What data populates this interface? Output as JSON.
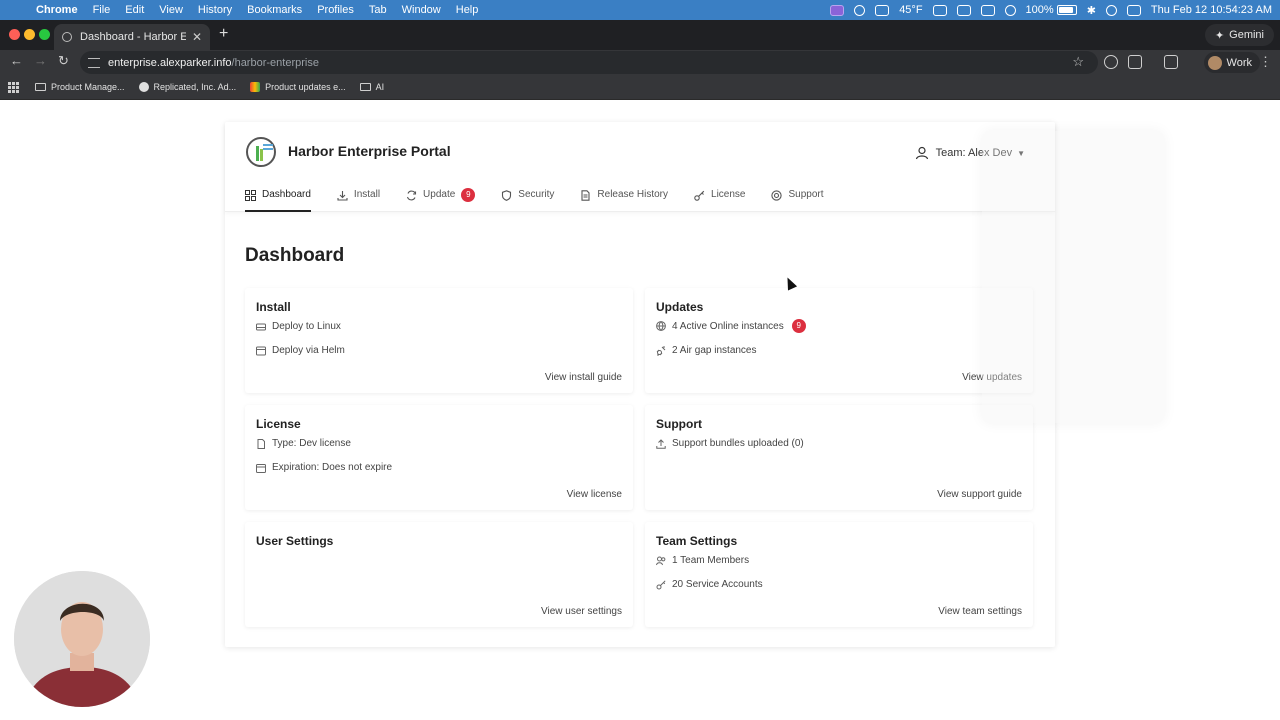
{
  "menubar": {
    "app": "Chrome",
    "items": [
      "File",
      "Edit",
      "View",
      "History",
      "Bookmarks",
      "Profiles",
      "Tab",
      "Window",
      "Help"
    ],
    "weather": "45°F",
    "battery": "100%",
    "datetime": "Thu Feb 12  10:54:23 AM"
  },
  "browser": {
    "tab_title": "Dashboard - Harbor Enterpris",
    "gemini_label": "Gemini",
    "url_host": "enterprise.alexparker.info",
    "url_path": "/harbor-enterprise",
    "profile_label": "Work",
    "bookmarks": [
      "Product Manage...",
      "Replicated, Inc. Ad...",
      "Product updates e...",
      "AI"
    ]
  },
  "portal": {
    "brand": "Harbor Enterprise Portal",
    "team_label": "Team: Alex Dev",
    "nav": [
      {
        "label": "Dashboard"
      },
      {
        "label": "Install"
      },
      {
        "label": "Update",
        "badge": "9"
      },
      {
        "label": "Security"
      },
      {
        "label": "Release History"
      },
      {
        "label": "License"
      },
      {
        "label": "Support"
      }
    ],
    "page_title": "Dashboard",
    "cards": {
      "install": {
        "title": "Install",
        "rows": [
          "Deploy to Linux",
          "Deploy via Helm"
        ],
        "link": "View install guide"
      },
      "updates": {
        "title": "Updates",
        "rows": [
          "4 Active Online instances",
          "2 Air gap instances"
        ],
        "badge": "9",
        "link": "View updates"
      },
      "license": {
        "title": "License",
        "rows": [
          "Type: Dev license",
          "Expiration: Does not expire"
        ],
        "link": "View license"
      },
      "support": {
        "title": "Support",
        "rows": [
          "Support bundles uploaded (0)"
        ],
        "link": "View support guide"
      },
      "user_settings": {
        "title": "User Settings",
        "link": "View user settings"
      },
      "team_settings": {
        "title": "Team Settings",
        "rows": [
          "1 Team Members",
          "20 Service Accounts"
        ],
        "link": "View team settings"
      }
    }
  },
  "colors": {
    "menubar": "#3a7fc4",
    "badge": "#dc2f3f",
    "browser_dark": "#353639"
  }
}
